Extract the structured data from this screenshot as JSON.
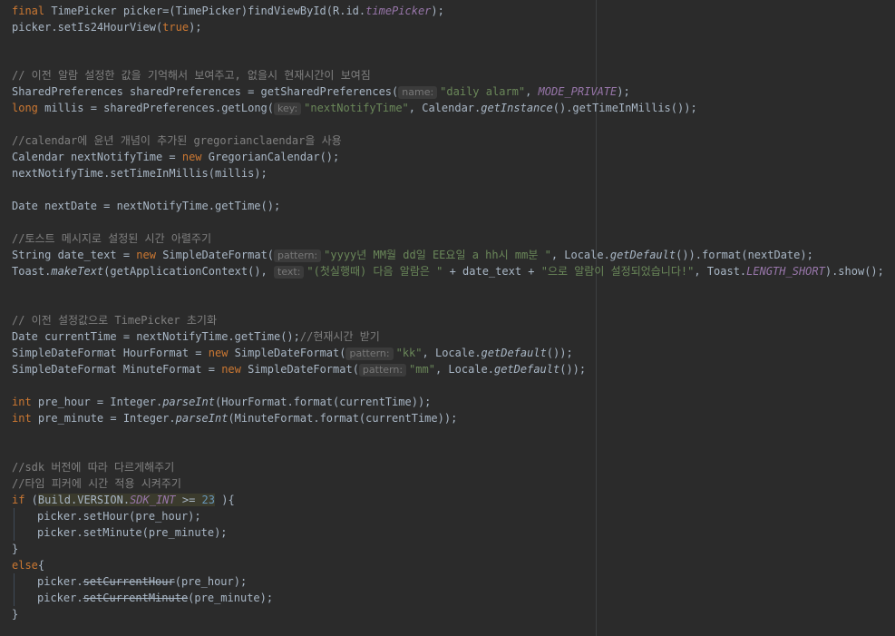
{
  "code": {
    "l1": {
      "kw1": "final",
      "t1": " TimePicker picker=(TimePicker)findViewById(R.id.",
      "fld": "timePicker",
      "t2": ");"
    },
    "l2": {
      "t1": "picker.setIs24HourView(",
      "kw": "true",
      "t2": ");"
    },
    "l3": {
      "cmt": "// 이전 알람 설정한 값을 기억해서 보여주고, 없을시 현재시간이 보여짐"
    },
    "l4": {
      "t1": "SharedPreferences sharedPreferences = getSharedPreferences(",
      "hint": "name:",
      "str": "\"daily alarm\"",
      "t2": ", ",
      "fld": "MODE_PRIVATE",
      "t3": ");"
    },
    "l5": {
      "kw": "long",
      "t1": " millis = sharedPreferences.getLong(",
      "hint": "key:",
      "str": "\"nextNotifyTime\"",
      "t2": ", Calendar.",
      "sm": "getInstance",
      "t3": "().getTimeInMillis());"
    },
    "l6": {
      "cmt": "//calendar에 윤년 개념이 추가된 gregorianclaendar을 사용"
    },
    "l7": {
      "t1": "Calendar nextNotifyTime = ",
      "kw": "new",
      "t2": " GregorianCalendar();"
    },
    "l8": {
      "t1": "nextNotifyTime.setTimeInMillis(millis);"
    },
    "l9": {
      "t1": "Date nextDate = nextNotifyTime.getTime();"
    },
    "l10": {
      "cmt": "//토스트 메시지로 설정된 시간 아렬주기"
    },
    "l11": {
      "t1": "String date_text = ",
      "kw": "new",
      "t2": " SimpleDateFormat(",
      "hint": "pattern:",
      "str": "\"yyyy년 MM월 dd일 EE요일 a hh시 mm분 \"",
      "t3": ", Locale.",
      "sm": "getDefault",
      "t4": "()).format(nextDate);"
    },
    "l12": {
      "t1": "Toast.",
      "sm": "makeText",
      "t2": "(getApplicationContext(), ",
      "hint": "text:",
      "str1": "\"(첫실행때) 다음 알람은 \"",
      "t3": " + date_text + ",
      "str2": "\"으로 알람이 설정되었습니다!\"",
      "t4": ", Toast.",
      "fld": "LENGTH_SHORT",
      "t5": ").show();"
    },
    "l13": {
      "cmt": "// 이전 설정값으로 TimePicker 초기화"
    },
    "l14": {
      "t1": "Date currentTime = nextNotifyTime.getTime();",
      "cmt": "//현재시간 받기"
    },
    "l15": {
      "t1": "SimpleDateFormat HourFormat = ",
      "kw": "new",
      "t2": " SimpleDateFormat(",
      "hint": "pattern:",
      "str": "\"kk\"",
      "t3": ", Locale.",
      "sm": "getDefault",
      "t4": "());"
    },
    "l16": {
      "t1": "SimpleDateFormat MinuteFormat = ",
      "kw": "new",
      "t2": " SimpleDateFormat(",
      "hint": "pattern:",
      "str": "\"mm\"",
      "t3": ", Locale.",
      "sm": "getDefault",
      "t4": "());"
    },
    "l17": {
      "kw": "int",
      "t1": " pre_hour = Integer.",
      "sm": "parseInt",
      "t2": "(HourFormat.format(currentTime));"
    },
    "l18": {
      "kw": "int",
      "t1": " pre_minute = Integer.",
      "sm": "parseInt",
      "t2": "(MinuteFormat.format(currentTime));"
    },
    "l19": {
      "cmt": "//sdk 버전에 따라 다르게해주기"
    },
    "l20": {
      "cmt": "//타임 피커에 시간 적용 시켜주기"
    },
    "l21": {
      "kw": "if",
      "t1": " (",
      "hl1": "Build.VERSION.",
      "fld": "SDK_INT",
      "hl2": " >= ",
      "num": "23",
      "t2": " ){"
    },
    "l22": {
      "t1": "picker.setHour(pre_hour);"
    },
    "l23": {
      "t1": "picker.setMinute(pre_minute);"
    },
    "l24": {
      "t1": "}"
    },
    "l25": {
      "kw": "else",
      "t1": "{"
    },
    "l26": {
      "t1": "picker.",
      "strike": "setCurrentHour",
      "t2": "(pre_hour);"
    },
    "l27": {
      "t1": "picker.",
      "strike": "setCurrentMinute",
      "t2": "(pre_minute);"
    },
    "l28": {
      "t1": "}"
    }
  }
}
